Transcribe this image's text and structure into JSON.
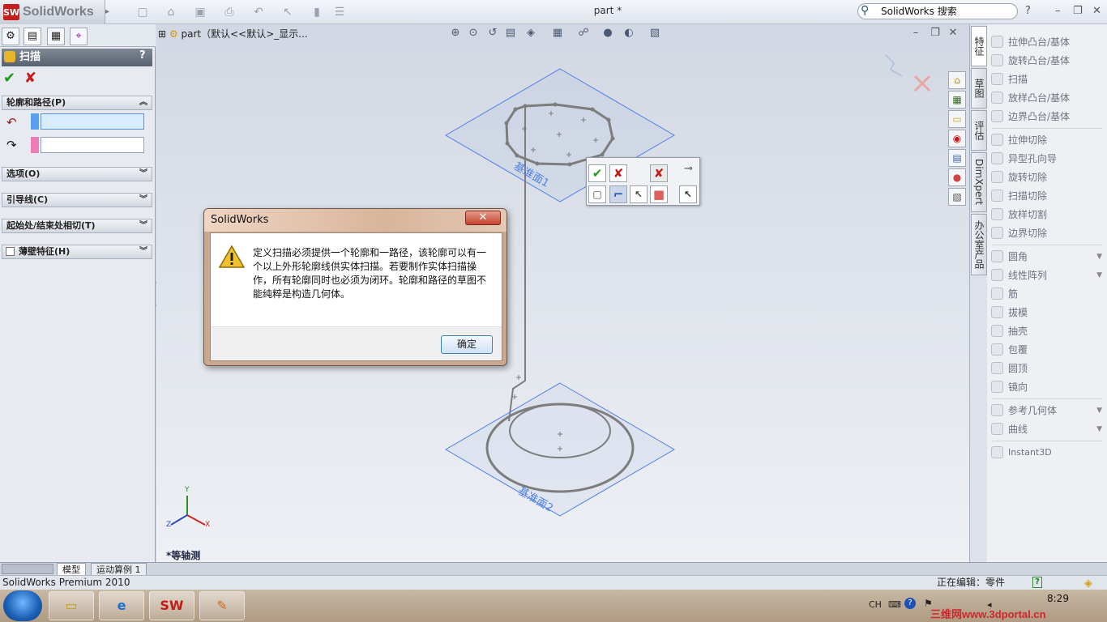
{
  "app": {
    "brand": "SolidWorks",
    "doc_title": "part *",
    "search_placeholder": "SolidWorks 搜索"
  },
  "property_manager": {
    "title": "扫描",
    "help": "?",
    "sections": {
      "profile_path": "轮廓和路径(P)",
      "options": "选项(O)",
      "guide_curves": "引导线(C)",
      "tangency": "起始处/结束处相切(T)",
      "thin_feature": "薄壁特征(H)"
    }
  },
  "viewport": {
    "tree_root": "part（默认<<默认>_显示...",
    "view_name": "*等轴测",
    "plane1": "基准面1",
    "plane2": "基准面2",
    "axis_x": "X",
    "axis_y": "Y",
    "axis_z": "Z"
  },
  "dialog": {
    "title": "SolidWorks",
    "close": "✕",
    "message": "定义扫描必须提供一个轮廓和一路径，该轮廓可以有一个以上外形轮廓线供实体扫描。若要制作实体扫描操作，所有轮廓同时也必须为闭环。轮廓和路径的草图不能纯粹是构造几何体。",
    "ok": "确定"
  },
  "right_tabs": [
    "特征",
    "草图",
    "评估",
    "DimXpert",
    "办公室产品"
  ],
  "features": [
    {
      "label": "拉伸凸台/基体",
      "dropdown": false
    },
    {
      "label": "旋转凸台/基体",
      "dropdown": false
    },
    {
      "label": "扫描",
      "dropdown": false
    },
    {
      "label": "放样凸台/基体",
      "dropdown": false
    },
    {
      "label": "边界凸台/基体",
      "dropdown": false
    },
    {
      "label": "拉伸切除",
      "dropdown": false
    },
    {
      "label": "异型孔向导",
      "dropdown": false
    },
    {
      "label": "旋转切除",
      "dropdown": false
    },
    {
      "label": "扫描切除",
      "dropdown": false
    },
    {
      "label": "放样切割",
      "dropdown": false
    },
    {
      "label": "边界切除",
      "dropdown": false
    },
    {
      "label": "圆角",
      "dropdown": true
    },
    {
      "label": "线性阵列",
      "dropdown": true
    },
    {
      "label": "筋",
      "dropdown": false
    },
    {
      "label": "拔模",
      "dropdown": false
    },
    {
      "label": "抽壳",
      "dropdown": false
    },
    {
      "label": "包覆",
      "dropdown": false
    },
    {
      "label": "圆顶",
      "dropdown": false
    },
    {
      "label": "镜向",
      "dropdown": false
    },
    {
      "label": "参考几何体",
      "dropdown": true
    },
    {
      "label": "曲线",
      "dropdown": true
    },
    {
      "label": "Instant3D",
      "dropdown": false
    }
  ],
  "bottom_tabs": [
    "模型",
    "运动算例 1"
  ],
  "status": {
    "product": "SolidWorks Premium 2010",
    "editing": "正在编辑：零件",
    "help": "?"
  },
  "taskbar": {
    "lang": "CH",
    "clock": "8:29",
    "watermark": "三维网www.3dportal.cn"
  },
  "colors": {
    "plane_blue": "#4f7fe8",
    "sketch_gray": "#7d7d7d",
    "ok_green": "#1d9b1d",
    "cancel_red": "#c41a1a"
  }
}
